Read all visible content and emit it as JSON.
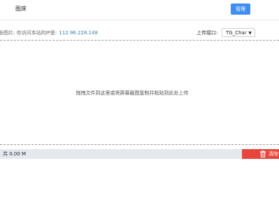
{
  "header": {
    "brand": "图床",
    "manage_label": "管理"
  },
  "info": {
    "prefix": "张图片; 你访问本站的IP是:",
    "ip": "112.96.228.148",
    "api_label": "上传接口:",
    "api_selected": "TG_Char",
    "api_select_icon": "chevron-down-icon"
  },
  "dropzone": {
    "hint": "拖拽文件到这里或将屏幕截图复制并粘贴到此处上传"
  },
  "footer": {
    "total": "共 0.00 M",
    "clear_label": "清除",
    "clear_icon": "trash-icon",
    "clear_color": "#e8453c"
  },
  "colors": {
    "primary": "#3f8ef0",
    "link": "#3b7fb8",
    "status_bg": "#e5e9ef"
  }
}
